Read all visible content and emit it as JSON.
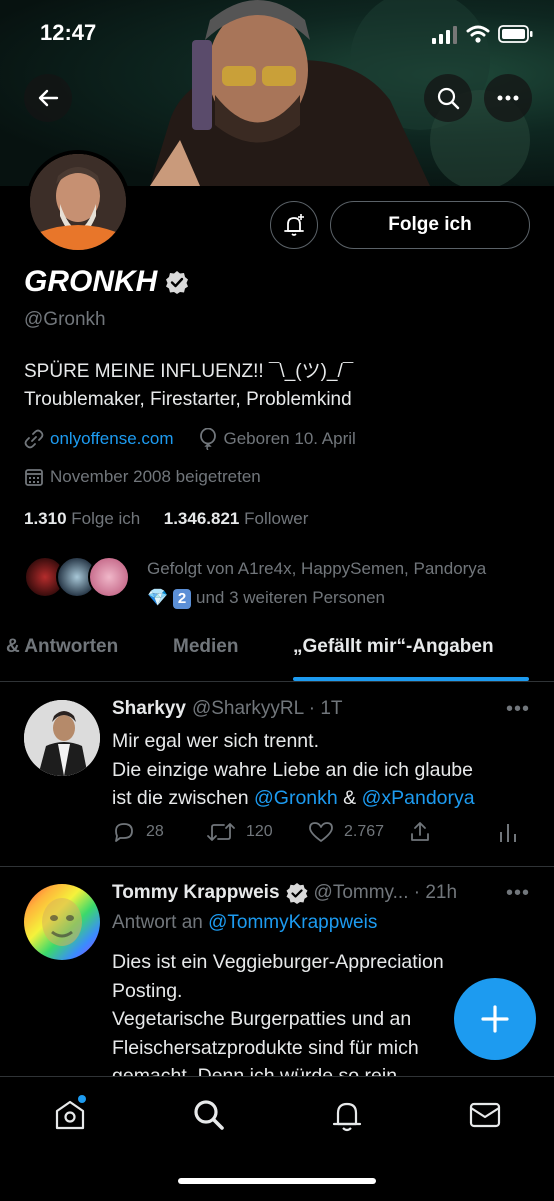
{
  "status": {
    "time": "12:47"
  },
  "profile": {
    "name": "GRONKH",
    "handle": "@Gronkh",
    "bio_line1": "SPÜRE MEINE INFLUENZ!! ¯\\_(ツ)_/¯",
    "bio_line2": "Troublemaker, Firestarter, Problemkind",
    "website": "onlyoffense.com",
    "birthday": "Geboren 10. April",
    "joined": "November 2008 beigetreten",
    "following_count": "1.310",
    "following_label": "Folge ich",
    "followers_count": "1.346.821",
    "followers_label": "Follower",
    "followed_by_line1": "Gefolgt von A1re4x, HappySemen, Pandorya",
    "followed_by_line2_emoji": "💎",
    "followed_by_line2_badge": "2",
    "followed_by_line2": "und 3 weiteren Personen",
    "follow_button": "Folge ich"
  },
  "tabs": [
    {
      "label": "& Antworten"
    },
    {
      "label": "Medien"
    },
    {
      "label": "„Gefällt mir“-Angaben",
      "active": true
    }
  ],
  "tweets": [
    {
      "name": "Sharkyy",
      "handle_time": "@SharkyyRL · 1T",
      "line1": "Mir egal wer sich trennt.",
      "line2": "Die einzige wahre Liebe an die ich glaube",
      "line3_pre": "ist die zwischen ",
      "mention1": "@Gronkh",
      "line3_mid": " & ",
      "mention2": "@xPandorya",
      "replies": "28",
      "retweets": "120",
      "likes": "2.767",
      "more": "•••"
    },
    {
      "name": "Tommy Krappweis",
      "handle_time": "@Tommy... · 21h",
      "reply_prefix": "Antwort an ",
      "reply_to": "@TommyKrappweis",
      "line1": "Dies ist ein Veggieburger-Appreciation",
      "line2": "Posting.",
      "line3": "Vegetarische Burgerpatties und an",
      "line4": "Fleischersatzprodukte sind für mich",
      "line5": "gemacht. Denn ich würde so rein",
      "more": "•••"
    }
  ],
  "icons": {
    "back": "arrow-left-icon",
    "search": "search-icon",
    "more": "more-icon",
    "bell": "bell-plus-icon",
    "verified": "verified-badge-icon",
    "link": "link-icon",
    "birthday": "balloon-icon",
    "calendar": "calendar-icon",
    "reply": "reply-icon",
    "retweet": "retweet-icon",
    "like": "heart-icon",
    "share": "share-icon",
    "analytics": "analytics-icon",
    "compose": "plus-icon",
    "nav_home": "home-icon",
    "nav_search": "search-icon",
    "nav_notifications": "bell-icon",
    "nav_messages": "mail-icon"
  },
  "colors": {
    "accent": "#1d9bf0",
    "muted": "#71767b",
    "text": "#e7e9ea",
    "background": "#000000"
  }
}
